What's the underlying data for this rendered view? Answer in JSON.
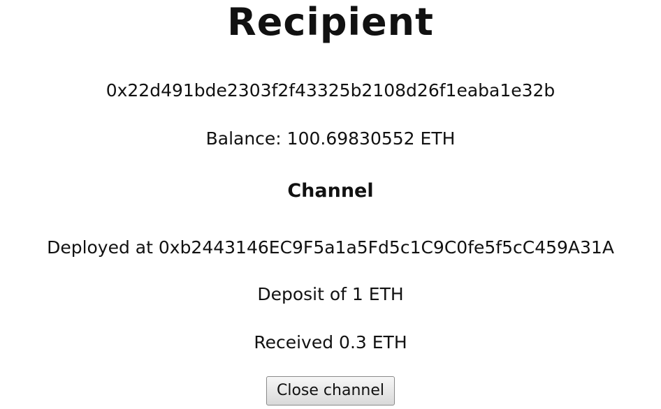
{
  "recipient": {
    "title": "Recipient",
    "address": "0x22d491bde2303f2f43325b2108d26f1eaba1e32b",
    "balance": "Balance: 100.69830552 ETH"
  },
  "channel": {
    "heading": "Channel",
    "deployed": "Deployed at 0xb2443146EC9F5a1a5Fd5c1C9C0fe5f5cC459A31A",
    "deposit": "Deposit of 1 ETH",
    "received": "Received 0.3 ETH",
    "close_button_label": "Close channel"
  }
}
